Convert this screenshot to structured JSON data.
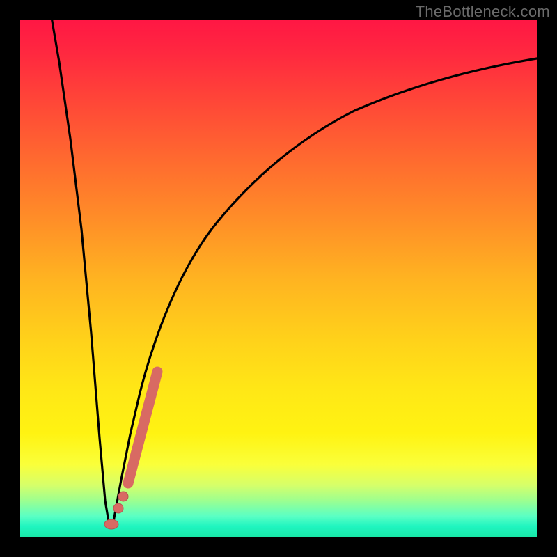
{
  "attribution": "TheBottleneck.com",
  "colors": {
    "frame": "#000000",
    "curve_stroke": "#000000",
    "marker_fill": "#d86a63",
    "marker_stroke": "#b7544f"
  },
  "chart_data": {
    "type": "line",
    "title": "",
    "xlabel": "",
    "ylabel": "",
    "xlim": [
      0,
      100
    ],
    "ylim": [
      0,
      100
    ],
    "series": [
      {
        "name": "bottleneck-curve",
        "x": [
          0,
          2,
          4,
          6,
          8,
          10,
          12,
          13.5,
          15,
          17,
          19,
          21,
          24,
          28,
          33,
          40,
          48,
          58,
          70,
          85,
          100
        ],
        "y": [
          100,
          85,
          71,
          56,
          42,
          27,
          13,
          2,
          4,
          16,
          27,
          37,
          49,
          60,
          69,
          77,
          83,
          88,
          91,
          93,
          94
        ]
      }
    ],
    "markers": [
      {
        "name": "segment-end-lower",
        "x": 16.0,
        "y": 4.0
      },
      {
        "name": "segment-dot-a",
        "x": 17.5,
        "y": 8.5
      },
      {
        "name": "segment-dot-b",
        "x": 18.5,
        "y": 12.0
      },
      {
        "name": "segment-bar-start",
        "x": 19.5,
        "y": 16.0
      },
      {
        "name": "segment-bar-end",
        "x": 24.0,
        "y": 37.0
      }
    ]
  }
}
